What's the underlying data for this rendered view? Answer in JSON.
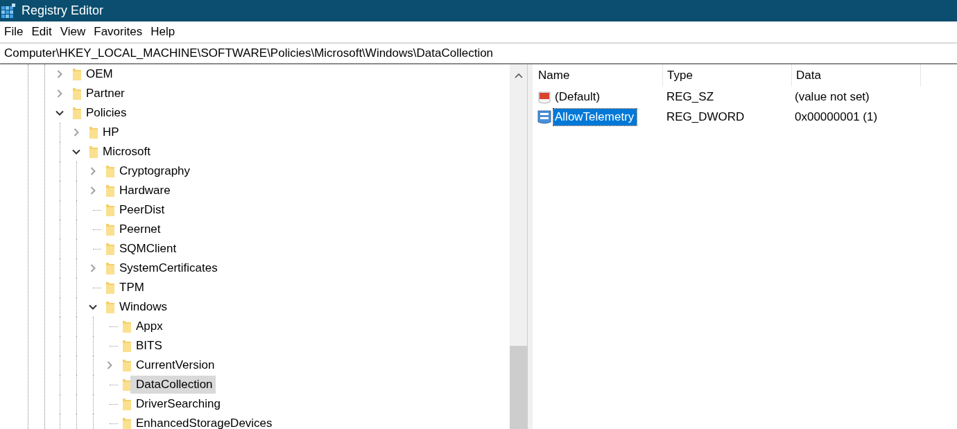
{
  "window": {
    "title": "Registry Editor"
  },
  "menu": [
    "File",
    "Edit",
    "View",
    "Favorites",
    "Help"
  ],
  "address": "Computer\\HKEY_LOCAL_MACHINE\\SOFTWARE\\Policies\\Microsoft\\Windows\\DataCollection",
  "tree": [
    {
      "label": "OEM",
      "kind": "branch",
      "expanded": false,
      "selected": false
    },
    {
      "label": "Partner",
      "kind": "branch",
      "expanded": false,
      "selected": false
    },
    {
      "label": "Policies",
      "kind": "branch",
      "expanded": true,
      "selected": false,
      "children": [
        {
          "label": "HP",
          "kind": "branch",
          "expanded": false,
          "selected": false
        },
        {
          "label": "Microsoft",
          "kind": "branch",
          "expanded": true,
          "selected": false,
          "children": [
            {
              "label": "Cryptography",
              "kind": "branch",
              "expanded": false,
              "selected": false
            },
            {
              "label": "Hardware",
              "kind": "branch",
              "expanded": false,
              "selected": false
            },
            {
              "label": "PeerDist",
              "kind": "leaf",
              "selected": false
            },
            {
              "label": "Peernet",
              "kind": "leaf",
              "selected": false
            },
            {
              "label": "SQMClient",
              "kind": "leaf",
              "selected": false
            },
            {
              "label": "SystemCertificates",
              "kind": "branch",
              "expanded": false,
              "selected": false
            },
            {
              "label": "TPM",
              "kind": "leaf",
              "selected": false
            },
            {
              "label": "Windows",
              "kind": "branch",
              "expanded": true,
              "selected": false,
              "children": [
                {
                  "label": "Appx",
                  "kind": "leaf",
                  "selected": false
                },
                {
                  "label": "BITS",
                  "kind": "leaf",
                  "selected": false
                },
                {
                  "label": "CurrentVersion",
                  "kind": "branch",
                  "expanded": false,
                  "selected": false
                },
                {
                  "label": "DataCollection",
                  "kind": "leaf",
                  "selected": true
                },
                {
                  "label": "DriverSearching",
                  "kind": "leaf",
                  "selected": false
                },
                {
                  "label": "EnhancedStorageDevices",
                  "kind": "leaf",
                  "selected": false
                }
              ]
            }
          ]
        }
      ]
    }
  ],
  "values": {
    "columns": [
      "Name",
      "Type",
      "Data"
    ],
    "rows": [
      {
        "name": "(Default)",
        "kind": "string",
        "type": "REG_SZ",
        "data": "(value not set)",
        "selected": false
      },
      {
        "name": "AllowTelemetry",
        "kind": "binary",
        "type": "REG_DWORD",
        "data": "0x00000001 (1)",
        "selected": true
      }
    ]
  }
}
